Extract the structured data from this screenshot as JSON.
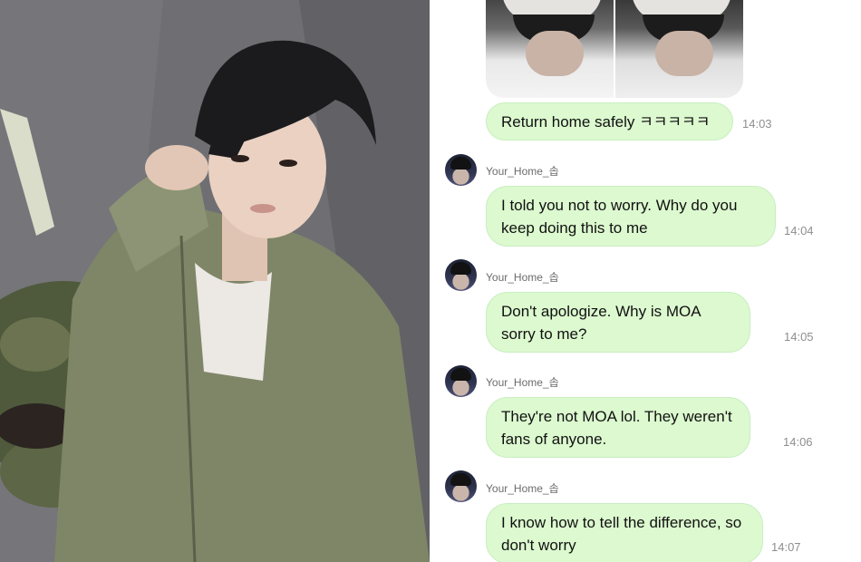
{
  "photo": {
    "description_icon": "person-photo"
  },
  "chat": {
    "shared_image": {
      "icon": "photo-thumbnail-icon"
    },
    "messages": [
      {
        "sender": "",
        "text": "Return home safely ㅋㅋㅋㅋㅋ",
        "time": "14:03"
      },
      {
        "sender": "Your_Home_솝",
        "text": "I told you not to worry. Why do you keep doing this to me",
        "time": "14:04"
      },
      {
        "sender": "Your_Home_솝",
        "text": "Don't apologize. Why is MOA sorry to me?",
        "time": "14:05"
      },
      {
        "sender": "Your_Home_솝",
        "text": "They're not MOA lol. They weren't fans of anyone.",
        "time": "14:06"
      },
      {
        "sender": "Your_Home_솝",
        "text": "I know how to tell the difference, so don't worry",
        "time": "14:07"
      }
    ]
  },
  "colors": {
    "bubble": "#dcf9cf",
    "bubble_border": "#c9eec0",
    "timestamp": "#8e8e8e"
  }
}
